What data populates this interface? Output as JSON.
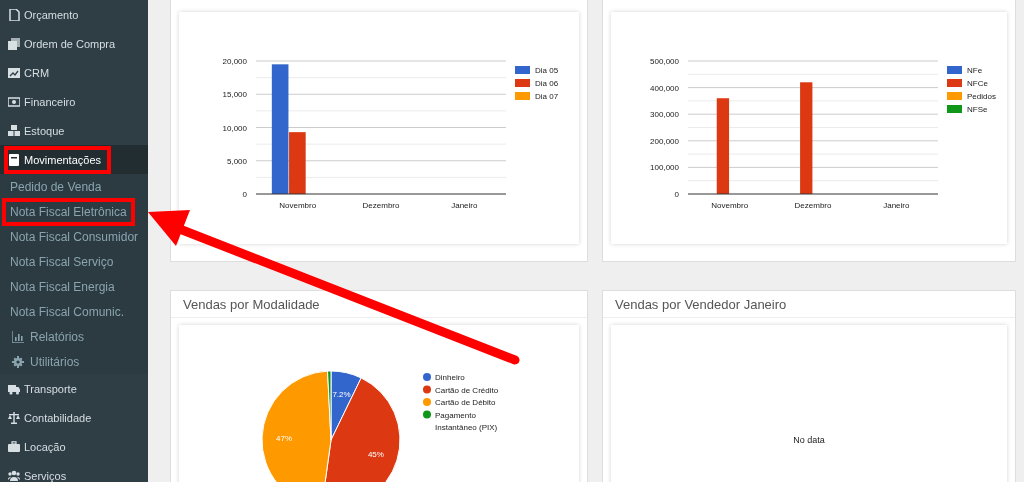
{
  "sidebar": {
    "items": [
      {
        "label": "Orçamento",
        "selected": false,
        "highlighted": false
      },
      {
        "label": "Ordem de Compra",
        "selected": false,
        "highlighted": false
      },
      {
        "label": "CRM",
        "selected": false,
        "highlighted": false
      },
      {
        "label": "Financeiro",
        "selected": false,
        "highlighted": false
      },
      {
        "label": "Estoque",
        "selected": false,
        "highlighted": false
      },
      {
        "label": "Movimentações",
        "selected": true,
        "highlighted": true,
        "children": [
          {
            "label": "Pedido de Venda",
            "kind": "link",
            "highlighted": false
          },
          {
            "label": "Nota Fiscal Eletrônica",
            "kind": "link",
            "highlighted": true
          },
          {
            "label": "Nota Fiscal Consumidor",
            "kind": "link",
            "highlighted": false
          },
          {
            "label": "Nota Fiscal Serviço",
            "kind": "link",
            "highlighted": false
          },
          {
            "label": "Nota Fiscal Energia",
            "kind": "link",
            "highlighted": false
          },
          {
            "label": "Nota Fiscal Comunic.",
            "kind": "link",
            "highlighted": false
          },
          {
            "label": "Relatórios",
            "kind": "submenu",
            "highlighted": false
          },
          {
            "label": "Utilitários",
            "kind": "submenu",
            "highlighted": false
          }
        ]
      },
      {
        "label": "Transporte",
        "selected": false,
        "highlighted": false
      },
      {
        "label": "Contabilidade",
        "selected": false,
        "highlighted": false
      },
      {
        "label": "Locação",
        "selected": false,
        "highlighted": false
      },
      {
        "label": "Serviços",
        "selected": false,
        "highlighted": false
      }
    ]
  },
  "panels": [
    {
      "chart_data": {
        "type": "bar",
        "grid": true,
        "legend": "right",
        "categories": [
          "Novembro",
          "Dezembro",
          "Janeiro"
        ],
        "ylim": [
          0,
          20000
        ],
        "yticks": [
          {
            "value": 0,
            "label": "0"
          },
          {
            "value": 5000,
            "label": "5,000"
          },
          {
            "value": 10000,
            "label": "10,000"
          },
          {
            "value": 15000,
            "label": "15,000"
          },
          {
            "value": 20000,
            "label": "20,000"
          }
        ],
        "series": [
          {
            "name": "Dia 05",
            "color": "#3366cc",
            "values": [
              19500,
              0,
              0
            ]
          },
          {
            "name": "Dia 06",
            "color": "#dc3912",
            "values": [
              9300,
              0,
              0
            ]
          },
          {
            "name": "Dia 07",
            "color": "#ff9900",
            "values": [
              0,
              0,
              0
            ]
          }
        ]
      }
    },
    {
      "chart_data": {
        "type": "bar",
        "grid": true,
        "legend": "right",
        "categories": [
          "Novembro",
          "Dezembro",
          "Janeiro"
        ],
        "ylim": [
          0,
          500000
        ],
        "yticks": [
          {
            "value": 0,
            "label": "0"
          },
          {
            "value": 100000,
            "label": "100,000"
          },
          {
            "value": 200000,
            "label": "200,000"
          },
          {
            "value": 300000,
            "label": "300,000"
          },
          {
            "value": 400000,
            "label": "400,000"
          },
          {
            "value": 500000,
            "label": "500,000"
          }
        ],
        "series": [
          {
            "name": "NFe",
            "color": "#3366cc",
            "values": [
              0,
              0,
              0
            ]
          },
          {
            "name": "NFCe",
            "color": "#dc3912",
            "values": [
              360000,
              420000,
              0
            ]
          },
          {
            "name": "Pedidos",
            "color": "#ff9900",
            "values": [
              0,
              0,
              0
            ]
          },
          {
            "name": "NFSe",
            "color": "#109618",
            "values": [
              0,
              0,
              0
            ]
          }
        ]
      }
    },
    {
      "title": "Vendas por Modalidade",
      "chart_data": {
        "type": "pie",
        "categories": [
          "Dinheiro",
          "Cartão de Crédito",
          "Cartão de Débito",
          "Pagamento Instantâneo (PIX)"
        ],
        "values": [
          7.2,
          45,
          47,
          0.8
        ],
        "value_labels": [
          "7.2%",
          "45%",
          "47%",
          null
        ],
        "legend": "right"
      }
    },
    {
      "title": "Vendas por Vendedor Janeiro",
      "empty_text": "No data"
    }
  ]
}
